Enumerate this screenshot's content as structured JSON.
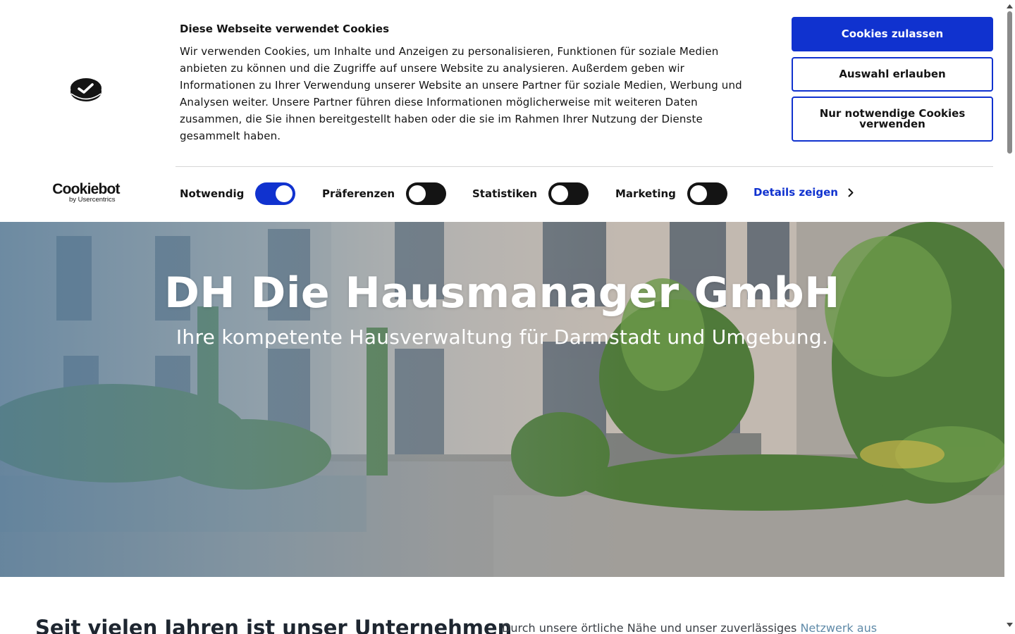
{
  "cookie_banner": {
    "title": "Diese Webseite verwendet Cookies",
    "body": "Wir verwenden Cookies, um Inhalte und Anzeigen zu personalisieren, Funktionen für soziale Medien anbieten zu können und die Zugriffe auf unsere Website zu analysieren. Außerdem geben wir Informationen zu Ihrer Verwendung unserer Website an unsere Partner für soziale Medien, Werbung und Analysen weiter. Unsere Partner führen diese Informationen möglicherweise mit weiteren Daten zusammen, die Sie ihnen bereitgestellt haben oder die sie im Rahmen Ihrer Nutzung der Dienste gesammelt haben.",
    "brand": {
      "name": "Cookiebot",
      "by": "by Usercentrics"
    },
    "buttons": {
      "allow_all": "Cookies zulassen",
      "allow_selection": "Auswahl erlauben",
      "necessary_only": "Nur notwendige Cookies verwenden"
    },
    "toggles": [
      {
        "label": "Notwendig",
        "checked": true
      },
      {
        "label": "Präferenzen",
        "checked": false
      },
      {
        "label": "Statistiken",
        "checked": false
      },
      {
        "label": "Marketing",
        "checked": false
      }
    ],
    "details_link": "Details zeigen",
    "colors": {
      "accent": "#1032cf",
      "text": "#141414"
    }
  },
  "hero": {
    "title": "DH Die Hausmanager GmbH",
    "subtitle": "Ihre kompetente Hausverwaltung für Darmstadt und Umgebung."
  },
  "intro": {
    "heading": "Seit vielen Jahren ist unser Unternehmen",
    "text": "Durch unsere örtliche Nähe und unser zuverlässiges ",
    "link": "Netzwerk aus"
  },
  "icons": {
    "cookiebot_logo": "cookie-check-icon",
    "details_chevron": "chevron-right-icon",
    "scroll_up": "triangle-up-icon",
    "scroll_down": "triangle-down-icon"
  }
}
